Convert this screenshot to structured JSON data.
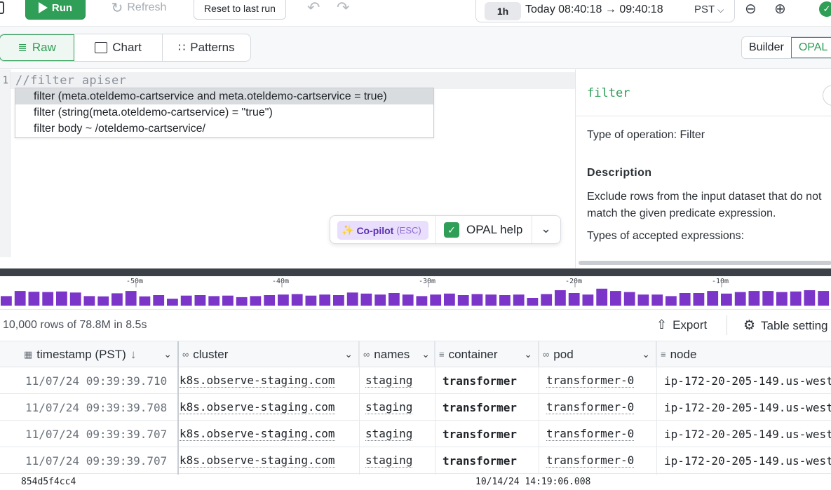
{
  "toolbar": {
    "run_label": "Run",
    "refresh_label": "Refresh",
    "reset_label": "Reset to last run",
    "range": "1h",
    "time_range": "Today 08:40:18 → 09:40:18",
    "timezone": "PST"
  },
  "view_tabs": [
    {
      "label": "Raw",
      "icon": "raw-icon",
      "active": true
    },
    {
      "label": "Chart",
      "icon": "chart-icon",
      "active": false
    },
    {
      "label": "Patterns",
      "icon": "patterns-icon",
      "active": false
    }
  ],
  "mode_tabs": [
    {
      "label": "Builder",
      "active": false
    },
    {
      "label": "OPAL",
      "active": true
    }
  ],
  "editor": {
    "line_number": "1",
    "code": "//filter apiser",
    "suggestions": [
      "filter (meta.oteldemo-cartservice and meta.oteldemo-cartservice = true)",
      "filter (string(meta.oteldemo-cartservice) = \"true\")",
      "filter body ~ /oteldemo-cartservice/"
    ],
    "copilot_label": "Co-pilot",
    "copilot_hint": "(ESC)",
    "opal_help_label": "OPAL help"
  },
  "help": {
    "title": "filter",
    "type_line": "Type of operation: Filter",
    "description_heading": "Description",
    "description": "Exclude rows from the input dataset that do not match the given predicate expression.",
    "accepted": "Types of accepted expressions:"
  },
  "histogram": {
    "tick_labels": [
      "-50m",
      "-40m",
      "-30m",
      "-20m",
      "-10m"
    ],
    "bar_heights": [
      0.62,
      0.95,
      0.9,
      0.88,
      0.92,
      0.85,
      0.62,
      0.6,
      0.8,
      0.95,
      0.6,
      0.68,
      0.45,
      0.65,
      0.68,
      0.62,
      0.65,
      0.55,
      0.62,
      0.68,
      0.72,
      0.75,
      0.65,
      0.72,
      0.68,
      0.85,
      0.78,
      0.72,
      0.82,
      0.72,
      0.62,
      0.72,
      0.78,
      0.68,
      0.75,
      0.72,
      0.68,
      0.72,
      0.5,
      0.75,
      1.0,
      0.82,
      0.72,
      1.1,
      0.95,
      0.88,
      0.72,
      0.72,
      0.62,
      0.82,
      0.82,
      0.95,
      0.78,
      0.88,
      0.95,
      0.95,
      0.88,
      0.92,
      1.0,
      0.95
    ],
    "bar_color": "#7b35c9"
  },
  "summary": {
    "rows_text": "10,000 rows of 78.8M in 8.5s",
    "export_label": "Export",
    "table_settings_label": "Table setting"
  },
  "table": {
    "columns": [
      "timestamp (PST)",
      "cluster",
      "names",
      "container",
      "pod",
      "node"
    ],
    "rows": [
      {
        "timestamp": "11/07/24 09:39:39.710",
        "cluster": "k8s.observe-staging.com",
        "names": "staging",
        "container": "transformer",
        "pod": "transformer-0",
        "node": "ip-172-20-205-149.us-west"
      },
      {
        "timestamp": "11/07/24 09:39:39.708",
        "cluster": "k8s.observe-staging.com",
        "names": "staging",
        "container": "transformer",
        "pod": "transformer-0",
        "node": "ip-172-20-205-149.us-west"
      },
      {
        "timestamp": "11/07/24 09:39:39.707",
        "cluster": "k8s.observe-staging.com",
        "names": "staging",
        "container": "transformer",
        "pod": "transformer-0",
        "node": "ip-172-20-205-149.us-west"
      },
      {
        "timestamp": "11/07/24 09:39:39.707",
        "cluster": "k8s.observe-staging.com",
        "names": "staging",
        "container": "transformer",
        "pod": "transformer-0",
        "node": "ip-172-20-205-149.us-west"
      }
    ]
  },
  "footer": {
    "left": "854d5f4cc4",
    "right": "10/14/24 14:19:06.008"
  }
}
